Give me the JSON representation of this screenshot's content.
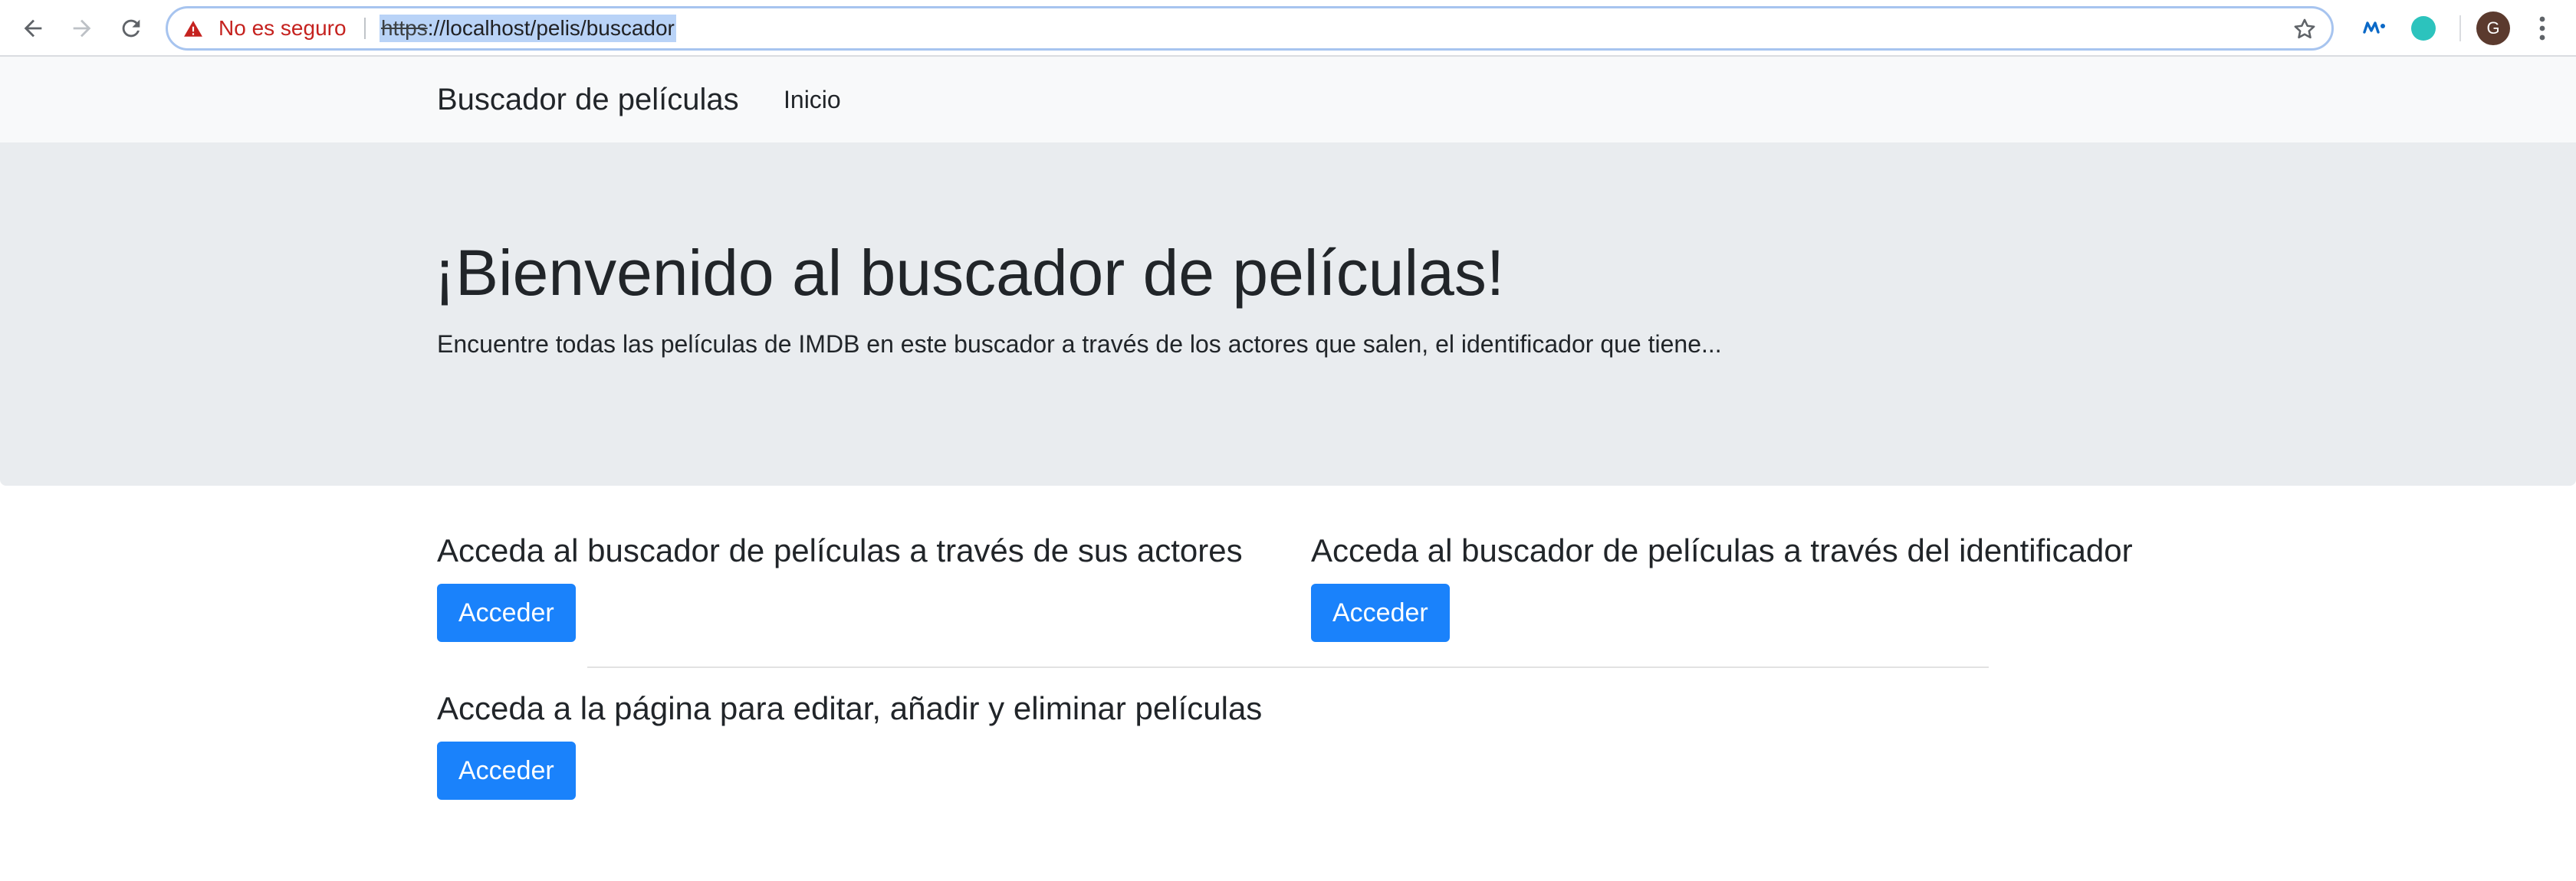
{
  "browser": {
    "security_label": "No es seguro",
    "url_scheme": "https",
    "url_rest": "://localhost/pelis/buscador",
    "avatar_letter": "G",
    "icons": [
      "back-arrow-icon",
      "forward-arrow-icon",
      "reload-icon",
      "warning-icon",
      "star-icon",
      "movistar-extension-icon",
      "teal-extension-icon",
      "menu-dots-icon"
    ],
    "colors": {
      "warning": "#c5221f",
      "omnibox_focus": "#a7c4ef",
      "url_selection": "#b9d3f7"
    }
  },
  "navbar": {
    "brand": "Buscador de películas",
    "links": [
      {
        "label": "Inicio"
      }
    ]
  },
  "jumbotron": {
    "title": "¡Bienvenido al buscador de películas!",
    "lead": "Encuentre todas las películas de IMDB en este buscador a través de los actores que salen, el identificador que tiene..."
  },
  "sections": [
    {
      "heading": "Acceda al buscador de películas a través de sus actores",
      "button": "Acceder"
    },
    {
      "heading": "Acceda al buscador de películas a través del identificador",
      "button": "Acceder"
    },
    {
      "heading": "Acceda a la página para editar, añadir y eliminar películas",
      "button": "Acceder"
    }
  ],
  "theme": {
    "primary": "#1a82fb",
    "navbar_bg": "#f8f9fa",
    "jumbotron_bg": "#e9ecef",
    "text": "#212529"
  }
}
